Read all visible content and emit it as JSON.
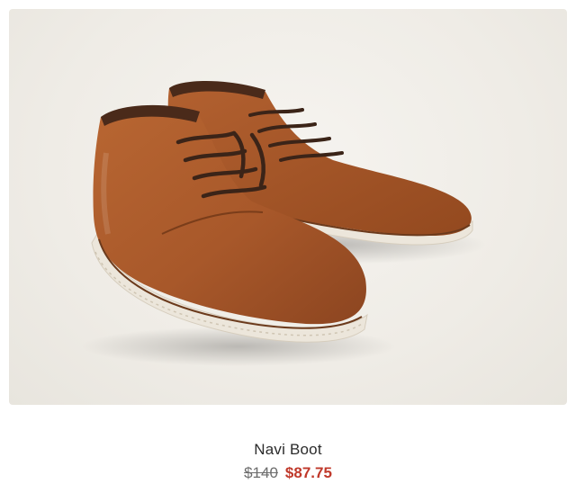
{
  "product": {
    "name": "Navi Boot",
    "original_price": "$140",
    "sale_price": "$87.75",
    "image_alt_icon": "boot-image"
  },
  "colors": {
    "sale_price": "#c0392b",
    "original_price": "#6d6d6d",
    "leather": "#a8582a",
    "sole": "#ece6db",
    "laces": "#3b2418"
  }
}
